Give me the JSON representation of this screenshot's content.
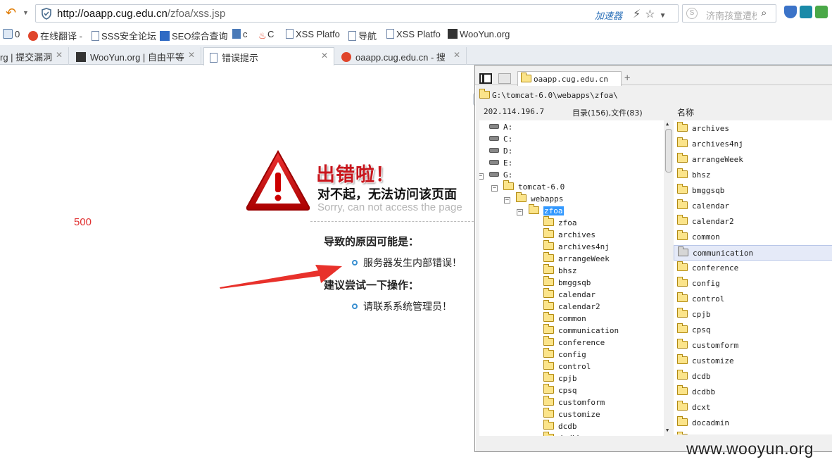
{
  "browser": {
    "url_host": "http://oaapp.cug.edu.cn",
    "url_path": "/zfoa/xss.jsp",
    "accelerator_label": "加速器",
    "search_placeholder": "济南孩童遭校",
    "bookmarks": [
      {
        "label": "0",
        "icon": "folder-icon"
      },
      {
        "label": "在线翻译 -",
        "icon": "sogou-icon"
      },
      {
        "label": "SSS安全论坛",
        "icon": "page-icon"
      },
      {
        "label": "SEO综合查询",
        "icon": "seo-icon"
      },
      {
        "label": "c",
        "icon": "bookmark-icon"
      },
      {
        "label": "C",
        "icon": "fire-icon"
      },
      {
        "label": "XSS Platfo",
        "icon": "page-icon"
      },
      {
        "label": "导航",
        "icon": "page-icon"
      },
      {
        "label": "XSS Platfo",
        "icon": "page-icon"
      },
      {
        "label": "WooYun.org",
        "icon": "wooyun-icon"
      }
    ],
    "tabs": [
      {
        "label": "rg | 提交漏洞",
        "active": false
      },
      {
        "label": "WooYun.org | 自由平等",
        "active": false
      },
      {
        "label": "错误提示",
        "active": true
      },
      {
        "label": "oaapp.cug.edu.cn - 搜",
        "active": false
      }
    ]
  },
  "error_page": {
    "title": "出错啦！",
    "subtitle": "对不起，无法访问该页面",
    "subtitle_en": "Sorry, can not access the page",
    "status_code": "500",
    "reason_heading": "导致的原因可能是：",
    "reason_item": "服务器发生内部错误！",
    "suggest_heading": "建议尝试一下操作：",
    "suggest_item": "请联系系统管理员！"
  },
  "file_manager": {
    "tab_label": "oaapp.cug.edu.cn",
    "path": "G:\\tomcat-6.0\\webapps\\zfoa\\",
    "ip": "202.114.196.7",
    "counts": "目录(156),文件(83)",
    "name_header": "名称",
    "drives": [
      "A:",
      "C:",
      "D:",
      "E:",
      "G:"
    ],
    "tree_nodes": [
      "tomcat-6.0",
      "webapps",
      "zfoa"
    ],
    "tree_children": [
      "zfoa",
      "archives",
      "archives4nj",
      "arrangeWeek",
      "bhsz",
      "bmggsqb",
      "calendar",
      "calendar2",
      "common",
      "communication",
      "conference",
      "config",
      "control",
      "cpjb",
      "cpsq",
      "customform",
      "customize",
      "dcdb",
      "dcdbb"
    ],
    "list_items": [
      "archives",
      "archives4nj",
      "arrangeWeek",
      "bhsz",
      "bmggsqb",
      "calendar",
      "calendar2",
      "common",
      "communication",
      "conference",
      "config",
      "control",
      "cpjb",
      "cpsq",
      "customform",
      "customize",
      "dcdb",
      "dcdbb",
      "dcxt",
      "docadmin",
      "docs"
    ],
    "highlighted_item": "communication"
  },
  "watermark": "www.wooyun.org"
}
